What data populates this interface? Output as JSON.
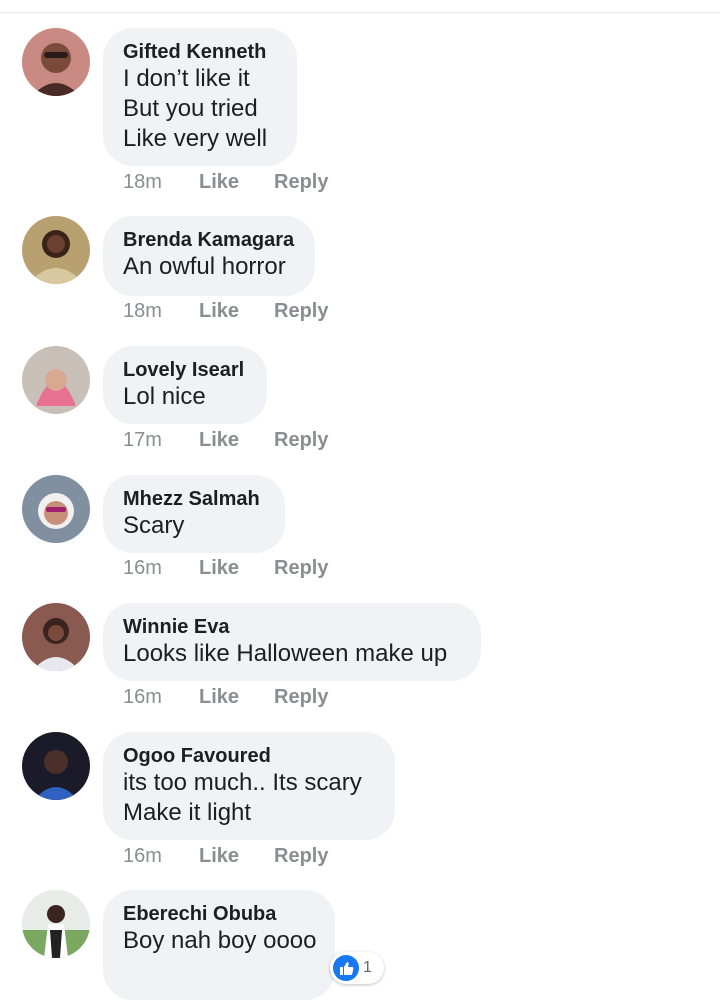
{
  "comments": [
    {
      "author": "Gifted Kenneth",
      "lines": [
        "I don’t like it",
        "But you tried",
        "Like very well"
      ],
      "time": "18m",
      "like": "Like",
      "reply": "Reply"
    },
    {
      "author": "Brenda Kamagara",
      "lines": [
        "An owful horror"
      ],
      "time": "18m",
      "like": "Like",
      "reply": "Reply"
    },
    {
      "author": "Lovely Isearl",
      "lines": [
        "Lol nice"
      ],
      "time": "17m",
      "like": "Like",
      "reply": "Reply"
    },
    {
      "author": "Mhezz Salmah",
      "lines": [
        "Scary"
      ],
      "time": "16m",
      "like": "Like",
      "reply": "Reply"
    },
    {
      "author": "Winnie Eva",
      "lines": [
        "Looks like Halloween make up"
      ],
      "time": "16m",
      "like": "Like",
      "reply": "Reply"
    },
    {
      "author": "Ogoo Favoured",
      "lines": [
        "its too much.. Its scary",
        "Make it light"
      ],
      "time": "16m",
      "like": "Like",
      "reply": "Reply"
    },
    {
      "author": "Eberechi Obuba",
      "lines": [
        "Boy nah boy oooo"
      ],
      "reaction": {
        "icon": "thumbs-up-icon",
        "count": "1"
      }
    }
  ],
  "colors": {
    "bubble": "#f0f2f5",
    "meta": "#8a8d91",
    "like_blue": "#1877f2"
  }
}
